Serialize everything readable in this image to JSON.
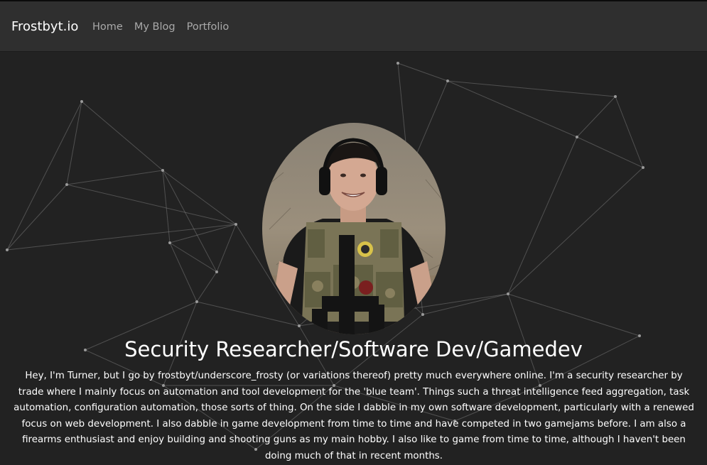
{
  "navbar": {
    "brand": "Frostbyt.io",
    "links": [
      {
        "label": "Home"
      },
      {
        "label": "My Blog"
      },
      {
        "label": "Portfolio"
      }
    ]
  },
  "hero": {
    "headline": "Security Researcher/Software Dev/Gamedev",
    "bio": "Hey, I'm Turner, but I go by frostbyt/underscore_frosty (or variations thereof) pretty much everywhere online. I'm a security researcher by trade where I mainly focus on automation and tool development for the 'blue team'. Things such a threat intelligence feed aggregation, task automation, configuration automation, those sorts of thing. On the side I dabble in my own software development, particularly with a renewed focus on web development. I also dabble in game development from time to time and have competed in two gamejams before. I am also a firearms enthusiast and enjoy building and shooting guns as my main hobby. I also like to game from time to time, although I haven't been doing much of that in recent months."
  },
  "colors": {
    "page_background": "#222222",
    "navbar_background": "#2f2f2f",
    "nav_link": "#a9a9a9",
    "text": "#ffffff"
  }
}
